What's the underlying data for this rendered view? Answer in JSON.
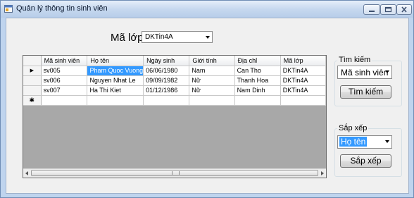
{
  "window": {
    "title": "Quản lý thông tin sinh viên",
    "accent": "#3399ff"
  },
  "class_filter": {
    "label": "Mã lớp",
    "value": "DKTin4A"
  },
  "grid": {
    "columns": [
      "Mã sinh viên",
      "Họ tên",
      "Ngày sinh",
      "Giới tính",
      "Địa chỉ",
      "Mã lớp"
    ],
    "rows": [
      [
        "sv005",
        "Pham Quoc Vuong",
        "06/06/1980",
        "Nam",
        "Can Tho",
        "DKTin4A"
      ],
      [
        "sv006",
        "Nguyen Nhat Le",
        "09/09/1982",
        "Nữ",
        "Thanh Hoa",
        "DKTin4A"
      ],
      [
        "sv007",
        "Ha Thi Kiet",
        "01/12/1986",
        "Nữ",
        "Nam Dinh",
        "DKTin4A"
      ]
    ],
    "current_row_marker": "▶",
    "new_row_marker": "✱"
  },
  "search": {
    "group_title": "Tìm kiếm",
    "field_value": "Mã sinh viên",
    "button_label": "Tìm kiếm"
  },
  "sort": {
    "group_title": "Sắp xếp",
    "field_value": "Họ tên",
    "button_label": "Sắp xếp"
  }
}
